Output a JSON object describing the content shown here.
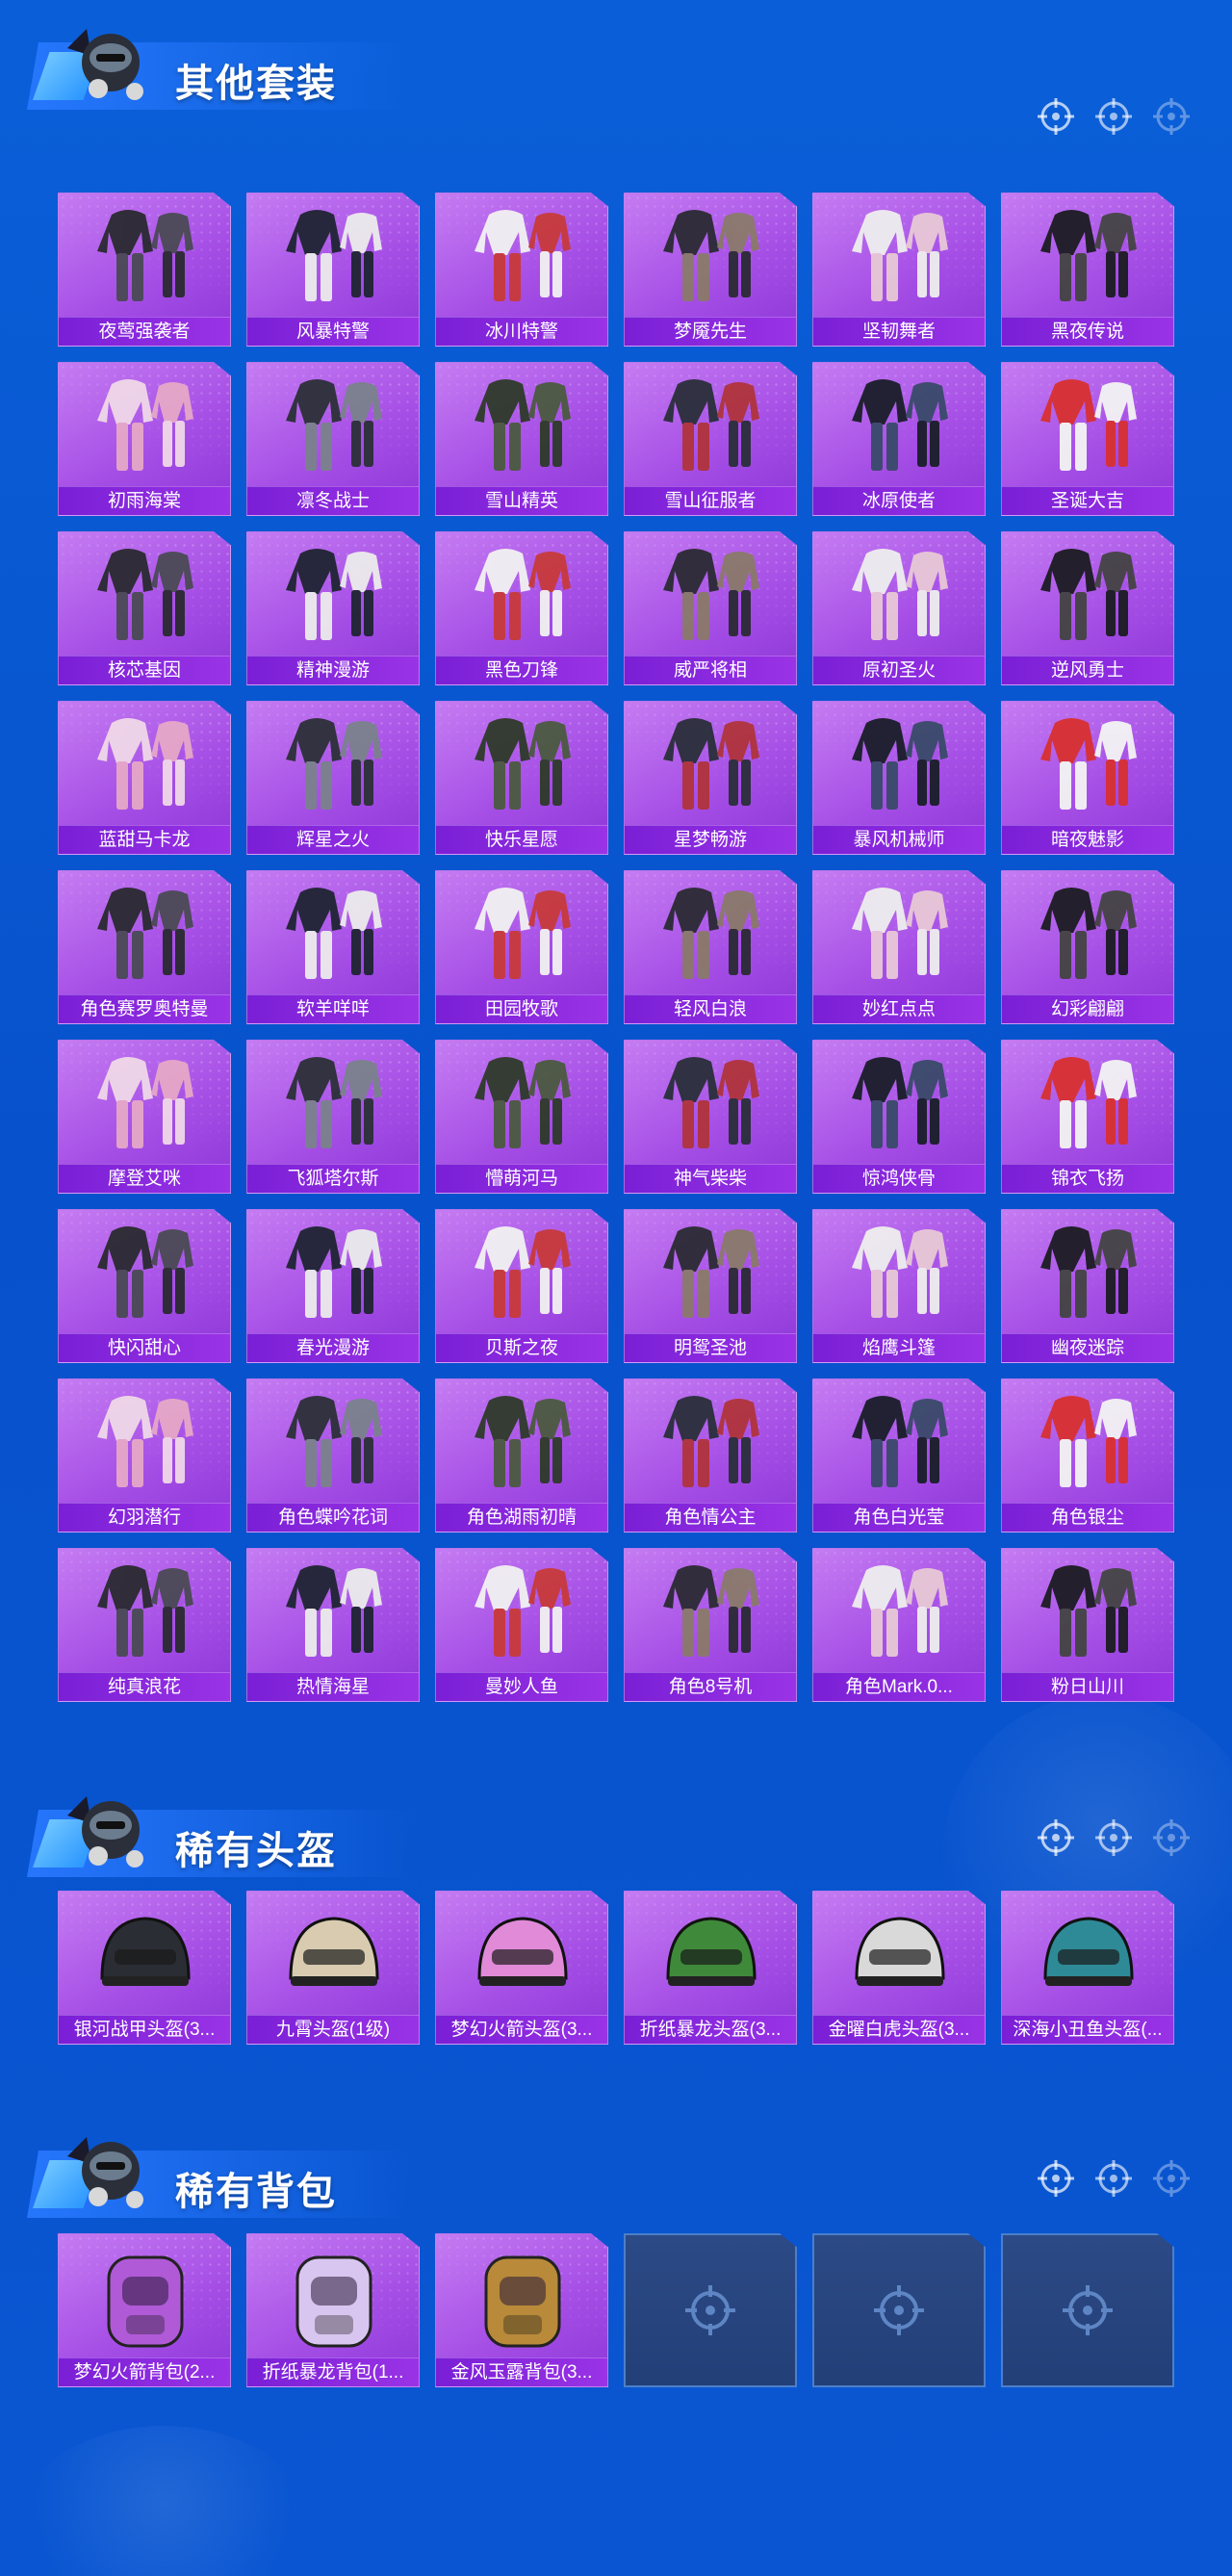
{
  "theme": {
    "card_gradient_top": "#c57cf2",
    "card_gradient_bottom": "#8c36d8",
    "label_bar": "#7a1fd6",
    "page_background": "#0752cc"
  },
  "sections": {
    "suits": {
      "title": "其他套装",
      "items": [
        {
          "label": "夜莺强袭者"
        },
        {
          "label": "风暴特警"
        },
        {
          "label": "冰川特警"
        },
        {
          "label": "梦魇先生"
        },
        {
          "label": "坚韧舞者"
        },
        {
          "label": "黑夜传说"
        },
        {
          "label": "初雨海棠"
        },
        {
          "label": "凛冬战士"
        },
        {
          "label": "雪山精英"
        },
        {
          "label": "雪山征服者"
        },
        {
          "label": "冰原使者"
        },
        {
          "label": "圣诞大吉"
        },
        {
          "label": "核芯基因"
        },
        {
          "label": "精神漫游"
        },
        {
          "label": "黑色刀锋"
        },
        {
          "label": "威严将相"
        },
        {
          "label": "原初圣火"
        },
        {
          "label": "逆风勇士"
        },
        {
          "label": "蓝甜马卡龙"
        },
        {
          "label": "辉星之火"
        },
        {
          "label": "快乐星愿"
        },
        {
          "label": "星梦畅游"
        },
        {
          "label": "暴风机械师"
        },
        {
          "label": "暗夜魅影"
        },
        {
          "label": "角色赛罗奥特曼"
        },
        {
          "label": "软羊咩咩"
        },
        {
          "label": "田园牧歌"
        },
        {
          "label": "轻风白浪"
        },
        {
          "label": "妙红点点"
        },
        {
          "label": "幻彩翩翩"
        },
        {
          "label": "摩登艾咪"
        },
        {
          "label": "飞狐塔尔斯"
        },
        {
          "label": "懵萌河马"
        },
        {
          "label": "神气柴柴"
        },
        {
          "label": "惊鸿侠骨"
        },
        {
          "label": "锦衣飞扬"
        },
        {
          "label": "快闪甜心"
        },
        {
          "label": "春光漫游"
        },
        {
          "label": "贝斯之夜"
        },
        {
          "label": "明鸳圣池"
        },
        {
          "label": "焰鹰斗篷"
        },
        {
          "label": "幽夜迷踪"
        },
        {
          "label": "幻羽潜行"
        },
        {
          "label": "角色蝶吟花词"
        },
        {
          "label": "角色湖雨初晴"
        },
        {
          "label": "角色情公主"
        },
        {
          "label": "角色白光莹"
        },
        {
          "label": "角色银尘"
        },
        {
          "label": "纯真浪花"
        },
        {
          "label": "热情海星"
        },
        {
          "label": "曼妙人鱼"
        },
        {
          "label": "角色8号机"
        },
        {
          "label": "角色Mark.0..."
        },
        {
          "label": "粉日山川"
        }
      ]
    },
    "helmets": {
      "title": "稀有头盔",
      "items": [
        {
          "label": "银河战甲头盔(3..."
        },
        {
          "label": "九霄头盔(1级)"
        },
        {
          "label": "梦幻火箭头盔(3..."
        },
        {
          "label": "折纸暴龙头盔(3..."
        },
        {
          "label": "金曜白虎头盔(3..."
        },
        {
          "label": "深海小丑鱼头盔(..."
        }
      ]
    },
    "backpacks": {
      "title": "稀有背包",
      "items": [
        {
          "label": "梦幻火箭背包(2..."
        },
        {
          "label": "折纸暴龙背包(1..."
        },
        {
          "label": "金风玉露背包(3..."
        }
      ],
      "empty_slots": 3
    }
  }
}
